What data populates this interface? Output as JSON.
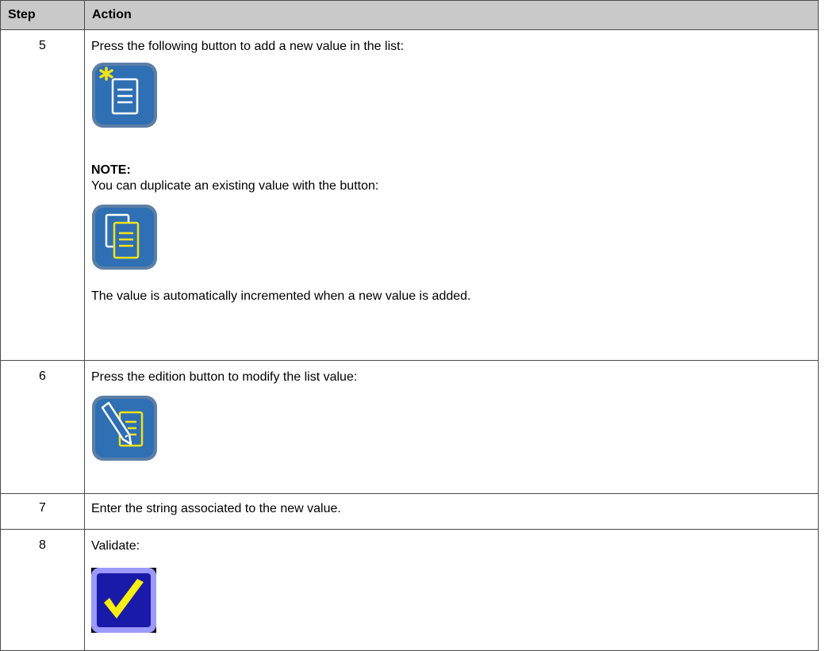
{
  "table": {
    "headers": {
      "step": "Step",
      "action": "Action"
    },
    "rows": [
      {
        "step": "5",
        "intro": "Press the following button to add a new value in the list:",
        "icon": "add-new-value-icon",
        "note_title": "NOTE:",
        "note_text": "You can duplicate an existing value with the button:",
        "note_icon": "duplicate-value-icon",
        "outro": "The value is automatically incremented when a new value is added."
      },
      {
        "step": "6",
        "intro": "Press the edition button to modify the list value:",
        "icon": "edit-value-icon"
      },
      {
        "step": "7",
        "intro": "Enter the string associated to the new value."
      },
      {
        "step": "8",
        "intro": "Validate:",
        "icon": "validate-checkmark-icon"
      }
    ]
  },
  "colors": {
    "header_bg": "#c9c9c9",
    "border": "#4a4a4a",
    "icon_blue": "#2f6fb3",
    "icon_yellow": "#f2e21a",
    "validate_bg": "#1a1aa8"
  }
}
